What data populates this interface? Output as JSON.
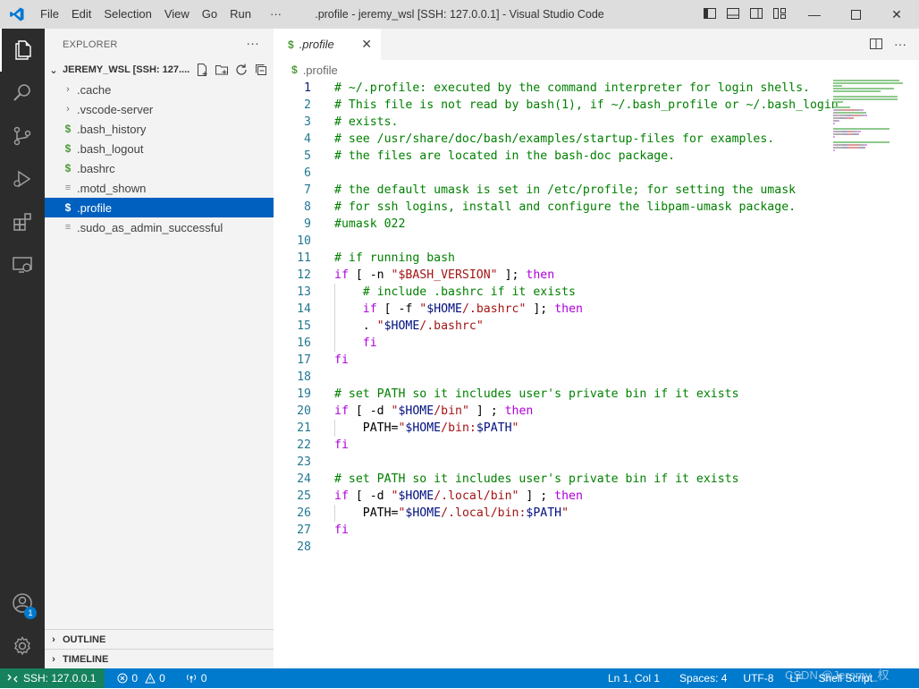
{
  "titlebar": {
    "menu": [
      "File",
      "Edit",
      "Selection",
      "View",
      "Go",
      "Run",
      "···"
    ],
    "title": ".profile - jeremy_wsl [SSH: 127.0.0.1] - Visual Studio Code"
  },
  "activitybar": {
    "accounts_badge": "1"
  },
  "sidebar": {
    "header": "EXPLORER",
    "more": "···",
    "root_label": "JEREMY_WSL [SSH: 127....",
    "items": [
      {
        "label": ".cache",
        "type": "folder"
      },
      {
        "label": ".vscode-server",
        "type": "folder"
      },
      {
        "label": ".bash_history",
        "type": "shell"
      },
      {
        "label": ".bash_logout",
        "type": "shell"
      },
      {
        "label": ".bashrc",
        "type": "shell"
      },
      {
        "label": ".motd_shown",
        "type": "text"
      },
      {
        "label": ".profile",
        "type": "shell",
        "selected": true
      },
      {
        "label": ".sudo_as_admin_successful",
        "type": "text"
      }
    ],
    "outline": "OUTLINE",
    "timeline": "TIMELINE"
  },
  "editor": {
    "tab_label": ".profile",
    "breadcrumb": ".profile",
    "current_line": 1,
    "lines": [
      [
        [
          "cm",
          "# ~/.profile: executed by the command interpreter for login shells."
        ]
      ],
      [
        [
          "cm",
          "# This file is not read by bash(1), if ~/.bash_profile or ~/.bash_login"
        ]
      ],
      [
        [
          "cm",
          "# exists."
        ]
      ],
      [
        [
          "cm",
          "# see /usr/share/doc/bash/examples/startup-files for examples."
        ]
      ],
      [
        [
          "cm",
          "# the files are located in the bash-doc package."
        ]
      ],
      [],
      [
        [
          "cm",
          "# the default umask is set in /etc/profile; for setting the umask"
        ]
      ],
      [
        [
          "cm",
          "# for ssh logins, install and configure the libpam-umask package."
        ]
      ],
      [
        [
          "cm",
          "#umask 022"
        ]
      ],
      [],
      [
        [
          "cm",
          "# if running bash"
        ]
      ],
      [
        [
          "kw",
          "if"
        ],
        [
          "pl",
          " [ -n "
        ],
        [
          "st",
          "\"$BASH_VERSION\""
        ],
        [
          "pl",
          " ]; "
        ],
        [
          "kw",
          "then"
        ]
      ],
      [
        [
          "pl",
          "    "
        ],
        [
          "cm",
          "# include .bashrc if it exists"
        ]
      ],
      [
        [
          "pl",
          "    "
        ],
        [
          "kw",
          "if"
        ],
        [
          "pl",
          " [ -f "
        ],
        [
          "st",
          "\""
        ],
        [
          "vr",
          "$HOME"
        ],
        [
          "st",
          "/.bashrc\""
        ],
        [
          "pl",
          " ]; "
        ],
        [
          "kw",
          "then"
        ]
      ],
      [
        [
          "pl",
          "    . "
        ],
        [
          "st",
          "\""
        ],
        [
          "vr",
          "$HOME"
        ],
        [
          "st",
          "/.bashrc\""
        ]
      ],
      [
        [
          "pl",
          "    "
        ],
        [
          "kw",
          "fi"
        ]
      ],
      [
        [
          "kw",
          "fi"
        ]
      ],
      [],
      [
        [
          "cm",
          "# set PATH so it includes user's private bin if it exists"
        ]
      ],
      [
        [
          "kw",
          "if"
        ],
        [
          "pl",
          " [ -d "
        ],
        [
          "st",
          "\""
        ],
        [
          "vr",
          "$HOME"
        ],
        [
          "st",
          "/bin\""
        ],
        [
          "pl",
          " ] ; "
        ],
        [
          "kw",
          "then"
        ]
      ],
      [
        [
          "pl",
          "    PATH="
        ],
        [
          "st",
          "\""
        ],
        [
          "vr",
          "$HOME"
        ],
        [
          "st",
          "/bin:"
        ],
        [
          "vr",
          "$PATH"
        ],
        [
          "st",
          "\""
        ]
      ],
      [
        [
          "kw",
          "fi"
        ]
      ],
      [],
      [
        [
          "cm",
          "# set PATH so it includes user's private bin if it exists"
        ]
      ],
      [
        [
          "kw",
          "if"
        ],
        [
          "pl",
          " [ -d "
        ],
        [
          "st",
          "\""
        ],
        [
          "vr",
          "$HOME"
        ],
        [
          "st",
          "/.local/bin\""
        ],
        [
          "pl",
          " ] ; "
        ],
        [
          "kw",
          "then"
        ]
      ],
      [
        [
          "pl",
          "    PATH="
        ],
        [
          "st",
          "\""
        ],
        [
          "vr",
          "$HOME"
        ],
        [
          "st",
          "/.local/bin:"
        ],
        [
          "vr",
          "$PATH"
        ],
        [
          "st",
          "\""
        ]
      ],
      [
        [
          "kw",
          "fi"
        ]
      ],
      []
    ]
  },
  "statusbar": {
    "remote": "SSH: 127.0.0.1",
    "errors": "0",
    "warnings": "0",
    "ports": "0",
    "position": "Ln 1, Col 1",
    "spaces": "Spaces: 4",
    "encoding": "UTF-8",
    "eol": "LF",
    "language": "Shell Script"
  },
  "watermark": "CSDN @Jeremy_权",
  "colors": {
    "activitybar": "#2c2c2c",
    "statusbar": "#007acc",
    "remote": "#16825d",
    "selection": "#0060c0",
    "comment": "#008000",
    "keyword": "#af00db",
    "string": "#a31515"
  }
}
